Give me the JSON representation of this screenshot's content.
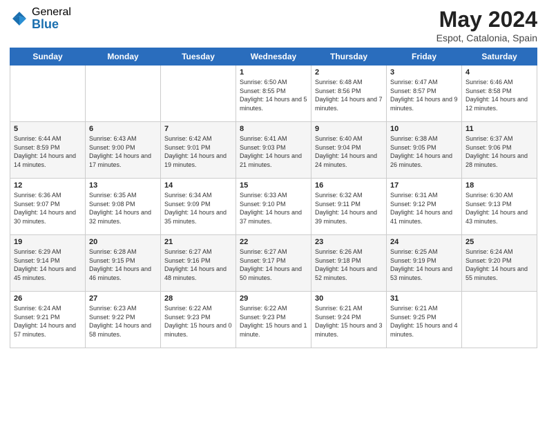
{
  "logo": {
    "general": "General",
    "blue": "Blue"
  },
  "title": "May 2024",
  "subtitle": "Espot, Catalonia, Spain",
  "headers": [
    "Sunday",
    "Monday",
    "Tuesday",
    "Wednesday",
    "Thursday",
    "Friday",
    "Saturday"
  ],
  "weeks": [
    [
      {
        "day": "",
        "info": ""
      },
      {
        "day": "",
        "info": ""
      },
      {
        "day": "",
        "info": ""
      },
      {
        "day": "1",
        "info": "Sunrise: 6:50 AM\nSunset: 8:55 PM\nDaylight: 14 hours\nand 5 minutes."
      },
      {
        "day": "2",
        "info": "Sunrise: 6:48 AM\nSunset: 8:56 PM\nDaylight: 14 hours\nand 7 minutes."
      },
      {
        "day": "3",
        "info": "Sunrise: 6:47 AM\nSunset: 8:57 PM\nDaylight: 14 hours\nand 9 minutes."
      },
      {
        "day": "4",
        "info": "Sunrise: 6:46 AM\nSunset: 8:58 PM\nDaylight: 14 hours\nand 12 minutes."
      }
    ],
    [
      {
        "day": "5",
        "info": "Sunrise: 6:44 AM\nSunset: 8:59 PM\nDaylight: 14 hours\nand 14 minutes."
      },
      {
        "day": "6",
        "info": "Sunrise: 6:43 AM\nSunset: 9:00 PM\nDaylight: 14 hours\nand 17 minutes."
      },
      {
        "day": "7",
        "info": "Sunrise: 6:42 AM\nSunset: 9:01 PM\nDaylight: 14 hours\nand 19 minutes."
      },
      {
        "day": "8",
        "info": "Sunrise: 6:41 AM\nSunset: 9:03 PM\nDaylight: 14 hours\nand 21 minutes."
      },
      {
        "day": "9",
        "info": "Sunrise: 6:40 AM\nSunset: 9:04 PM\nDaylight: 14 hours\nand 24 minutes."
      },
      {
        "day": "10",
        "info": "Sunrise: 6:38 AM\nSunset: 9:05 PM\nDaylight: 14 hours\nand 26 minutes."
      },
      {
        "day": "11",
        "info": "Sunrise: 6:37 AM\nSunset: 9:06 PM\nDaylight: 14 hours\nand 28 minutes."
      }
    ],
    [
      {
        "day": "12",
        "info": "Sunrise: 6:36 AM\nSunset: 9:07 PM\nDaylight: 14 hours\nand 30 minutes."
      },
      {
        "day": "13",
        "info": "Sunrise: 6:35 AM\nSunset: 9:08 PM\nDaylight: 14 hours\nand 32 minutes."
      },
      {
        "day": "14",
        "info": "Sunrise: 6:34 AM\nSunset: 9:09 PM\nDaylight: 14 hours\nand 35 minutes."
      },
      {
        "day": "15",
        "info": "Sunrise: 6:33 AM\nSunset: 9:10 PM\nDaylight: 14 hours\nand 37 minutes."
      },
      {
        "day": "16",
        "info": "Sunrise: 6:32 AM\nSunset: 9:11 PM\nDaylight: 14 hours\nand 39 minutes."
      },
      {
        "day": "17",
        "info": "Sunrise: 6:31 AM\nSunset: 9:12 PM\nDaylight: 14 hours\nand 41 minutes."
      },
      {
        "day": "18",
        "info": "Sunrise: 6:30 AM\nSunset: 9:13 PM\nDaylight: 14 hours\nand 43 minutes."
      }
    ],
    [
      {
        "day": "19",
        "info": "Sunrise: 6:29 AM\nSunset: 9:14 PM\nDaylight: 14 hours\nand 45 minutes."
      },
      {
        "day": "20",
        "info": "Sunrise: 6:28 AM\nSunset: 9:15 PM\nDaylight: 14 hours\nand 46 minutes."
      },
      {
        "day": "21",
        "info": "Sunrise: 6:27 AM\nSunset: 9:16 PM\nDaylight: 14 hours\nand 48 minutes."
      },
      {
        "day": "22",
        "info": "Sunrise: 6:27 AM\nSunset: 9:17 PM\nDaylight: 14 hours\nand 50 minutes."
      },
      {
        "day": "23",
        "info": "Sunrise: 6:26 AM\nSunset: 9:18 PM\nDaylight: 14 hours\nand 52 minutes."
      },
      {
        "day": "24",
        "info": "Sunrise: 6:25 AM\nSunset: 9:19 PM\nDaylight: 14 hours\nand 53 minutes."
      },
      {
        "day": "25",
        "info": "Sunrise: 6:24 AM\nSunset: 9:20 PM\nDaylight: 14 hours\nand 55 minutes."
      }
    ],
    [
      {
        "day": "26",
        "info": "Sunrise: 6:24 AM\nSunset: 9:21 PM\nDaylight: 14 hours\nand 57 minutes."
      },
      {
        "day": "27",
        "info": "Sunrise: 6:23 AM\nSunset: 9:22 PM\nDaylight: 14 hours\nand 58 minutes."
      },
      {
        "day": "28",
        "info": "Sunrise: 6:22 AM\nSunset: 9:23 PM\nDaylight: 15 hours\nand 0 minutes."
      },
      {
        "day": "29",
        "info": "Sunrise: 6:22 AM\nSunset: 9:23 PM\nDaylight: 15 hours\nand 1 minute."
      },
      {
        "day": "30",
        "info": "Sunrise: 6:21 AM\nSunset: 9:24 PM\nDaylight: 15 hours\nand 3 minutes."
      },
      {
        "day": "31",
        "info": "Sunrise: 6:21 AM\nSunset: 9:25 PM\nDaylight: 15 hours\nand 4 minutes."
      },
      {
        "day": "",
        "info": ""
      }
    ]
  ]
}
